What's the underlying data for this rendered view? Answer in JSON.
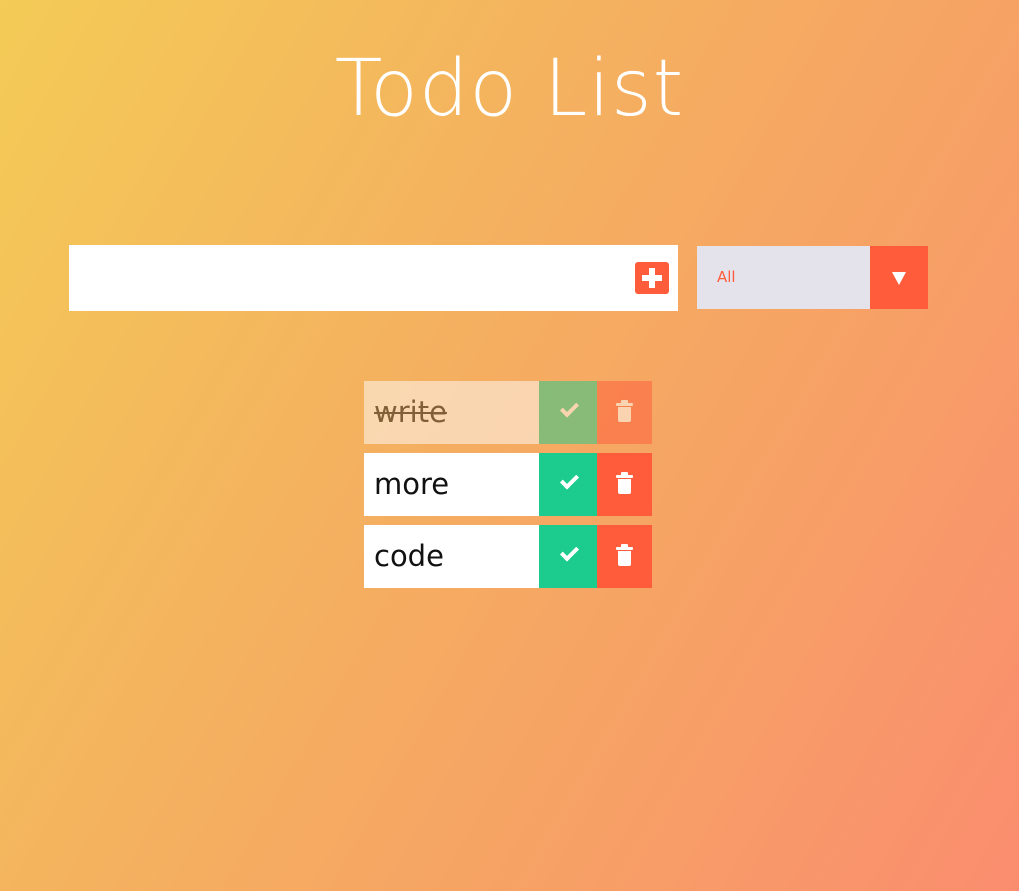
{
  "header": {
    "title": "Todo List"
  },
  "add_form": {
    "input_value": "",
    "input_placeholder": "",
    "add_icon": "plus-square-icon"
  },
  "filter": {
    "selected": "All",
    "options": [
      "All"
    ],
    "arrow_icon": "caret-down-icon"
  },
  "todos": [
    {
      "text": "write",
      "completed": true
    },
    {
      "text": "more",
      "completed": false
    },
    {
      "text": "code",
      "completed": false
    }
  ],
  "colors": {
    "accent": "#ff5c3c",
    "complete": "#1ccb8e",
    "filter_bg": "#e4e2ea",
    "gradient_start": "#f4cb56",
    "gradient_end": "#fa8d6f"
  }
}
